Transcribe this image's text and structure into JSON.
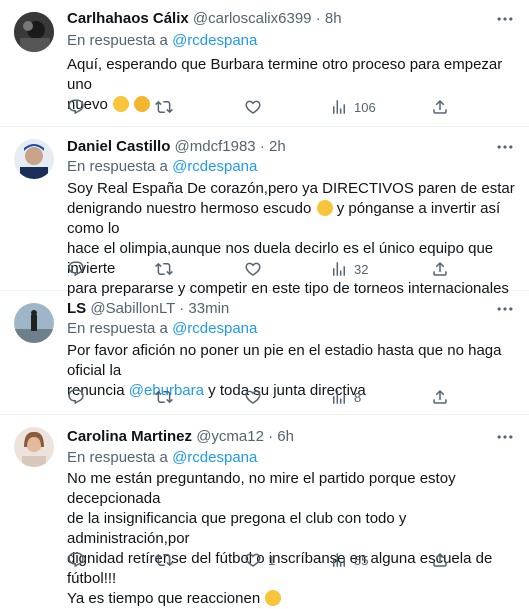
{
  "tweets": [
    {
      "name": "Carlhahaos Cálix",
      "handle": "@carloscalix6399",
      "time": "8h",
      "reply_prefix": "En respuesta a",
      "reply_to": "@rcdespana",
      "text_line1": "Aquí, esperando que Burbara termine otro proceso para empezar uno",
      "text_line2": "nuevo",
      "reply_count": "",
      "retweet_count": "",
      "like_count": "",
      "view_count": "106"
    },
    {
      "name": "Daniel Castillo",
      "handle": "@mdcf1983",
      "time": "2h",
      "reply_prefix": "En respuesta a",
      "reply_to": "@rcdespana",
      "text_line1": "Soy Real España De corazón,pero ya DIRECTIVOS paren de estar",
      "text_line2a": "denigrando nuestro hermoso escudo",
      "text_line2b": "y pónganse a invertir así como lo",
      "text_line3": "hace el olimpia,aunque nos duela decirlo es el único equipo que invierte",
      "text_line4": "para prepararse y competir en este tipo de torneos internacionales",
      "reply_count": "",
      "retweet_count": "",
      "like_count": "",
      "view_count": "32"
    },
    {
      "name": "LS",
      "handle": "@SabillonLT",
      "time": "33min",
      "reply_prefix": "En respuesta a",
      "reply_to": "@rcdespana",
      "text_line1": "Por favor afición no poner un pie en el estadio hasta que no haga oficial la",
      "text_line2a": "renuncia",
      "text_mention": "@eburbara",
      "text_line2b": "y toda su junta directiva",
      "reply_count": "",
      "retweet_count": "",
      "like_count": "",
      "view_count": "8"
    },
    {
      "name": "Carolina Martinez",
      "handle": "@ycma12",
      "time": "6h",
      "reply_prefix": "En respuesta a",
      "reply_to": "@rcdespana",
      "text_line1": "No me están preguntando, no mire el partido porque estoy decepcionada",
      "text_line2": "de la insignificancia que pregona el club con todo y administración,por",
      "text_line3": "dignidad retírense del fútbol o inscríbanse en alguna escuela de fútbol!!!",
      "text_line4": "Ya es tiempo que reaccionen",
      "reply_count": "",
      "retweet_count": "",
      "like_count": "1",
      "view_count": "55"
    }
  ],
  "icons": [
    "reply-icon",
    "retweet-icon",
    "like-icon",
    "views-icon",
    "share-icon",
    "more-icon"
  ],
  "colors": {
    "text": "#0f1419",
    "secondary": "#536471",
    "link": "#1d9bf0",
    "divider": "#eff3f4"
  }
}
